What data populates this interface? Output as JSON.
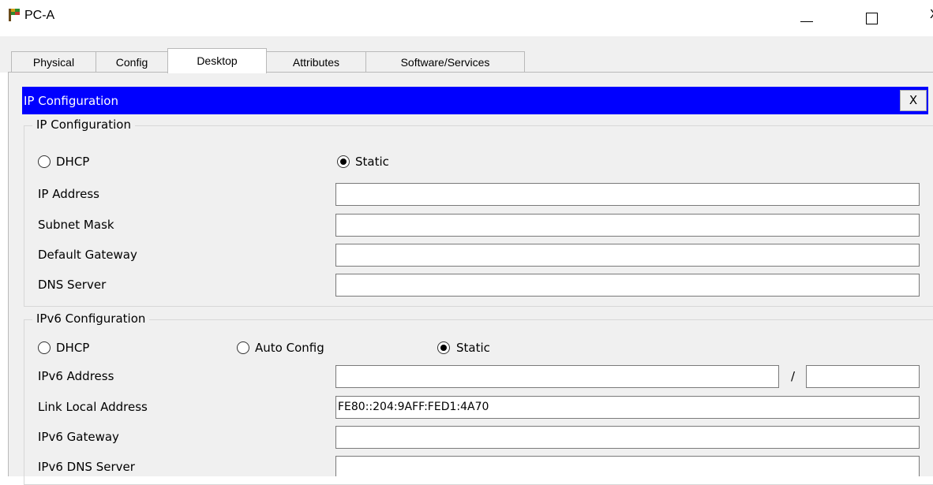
{
  "window": {
    "title": "PC-A"
  },
  "tabs": [
    {
      "label": "Physical",
      "active": false
    },
    {
      "label": "Config",
      "active": false
    },
    {
      "label": "Desktop",
      "active": true
    },
    {
      "label": "Attributes",
      "active": false
    },
    {
      "label": "Software/Services",
      "active": false
    }
  ],
  "dialog": {
    "title": "IP Configuration",
    "close_label": "X",
    "title_bar_color": "#0000ff"
  },
  "ipv4": {
    "legend": "IP Configuration",
    "dhcp_label": "DHCP",
    "static_label": "Static",
    "mode": "Static",
    "fields": {
      "ip_address": {
        "label": "IP Address",
        "value": ""
      },
      "subnet_mask": {
        "label": "Subnet Mask",
        "value": ""
      },
      "default_gateway": {
        "label": "Default Gateway",
        "value": ""
      },
      "dns_server": {
        "label": "DNS Server",
        "value": ""
      }
    }
  },
  "ipv6": {
    "legend": "IPv6 Configuration",
    "dhcp_label": "DHCP",
    "auto_config_label": "Auto Config",
    "static_label": "Static",
    "mode": "Static",
    "prefix_separator": "/",
    "fields": {
      "ipv6_address": {
        "label": "IPv6 Address",
        "value": "",
        "prefix_length": ""
      },
      "link_local_address": {
        "label": "Link Local Address",
        "value": "FE80::204:9AFF:FED1:4A70"
      },
      "ipv6_gateway": {
        "label": "IPv6 Gateway",
        "value": ""
      },
      "ipv6_dns_server": {
        "label": "IPv6 DNS Server",
        "value": ""
      }
    }
  }
}
